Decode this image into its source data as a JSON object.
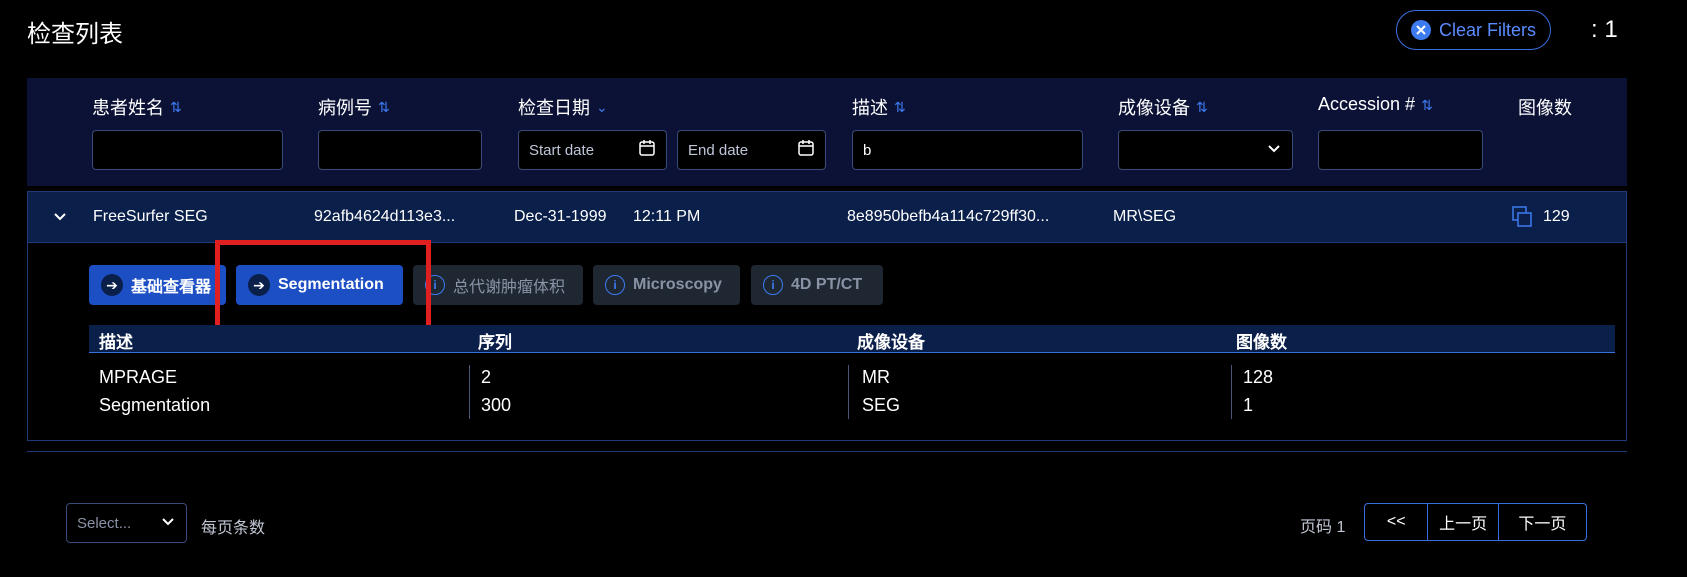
{
  "page": {
    "title": "检查列表",
    "clear_filters_label": "Clear Filters",
    "study_count": ": 1"
  },
  "columns": {
    "patient_name": "患者姓名",
    "mrn": "病例号",
    "study_date": "检查日期",
    "description": "描述",
    "modality": "成像设备",
    "accession": "Accession #",
    "instances": "图像数"
  },
  "filters": {
    "patient_name": "",
    "mrn": "",
    "start_date_placeholder": "Start date",
    "end_date_placeholder": "End date",
    "description": "b",
    "modality": "",
    "accession": ""
  },
  "study": {
    "patient_name": "FreeSurfer SEG",
    "mrn": "92afb4624d113e3...",
    "date": "Dec-31-1999",
    "time": "12:11 PM",
    "description": "8e8950befb4a114c729ff30...",
    "modality": "MR\\SEG",
    "instances": "129"
  },
  "modes": [
    {
      "label": "基础查看器",
      "state": "active",
      "icon": "arrow-right-icon"
    },
    {
      "label": "Segmentation",
      "state": "active",
      "icon": "arrow-right-icon"
    },
    {
      "label": "总代谢肿瘤体积",
      "state": "disabled",
      "icon": "info-icon"
    },
    {
      "label": "Microscopy",
      "state": "disabled",
      "icon": "info-icon"
    },
    {
      "label": "4D PT/CT",
      "state": "disabled",
      "icon": "info-icon"
    }
  ],
  "series_table": {
    "headers": [
      "描述",
      "序列",
      "成像设备",
      "图像数"
    ],
    "rows": [
      [
        "MPRAGE",
        "2",
        "MR",
        "128"
      ],
      [
        "Segmentation",
        "300",
        "SEG",
        "1"
      ]
    ]
  },
  "pagination": {
    "page_size_placeholder": "Select...",
    "page_size_label": "每页条数",
    "page_label": "页码 1",
    "first": "<<",
    "prev": "上一页",
    "next": "下一页"
  },
  "colors": {
    "accent": "#3d7bf0",
    "highlight": "#e02020",
    "active_button": "#1d4fc4",
    "header_bg": "#0b1236"
  }
}
